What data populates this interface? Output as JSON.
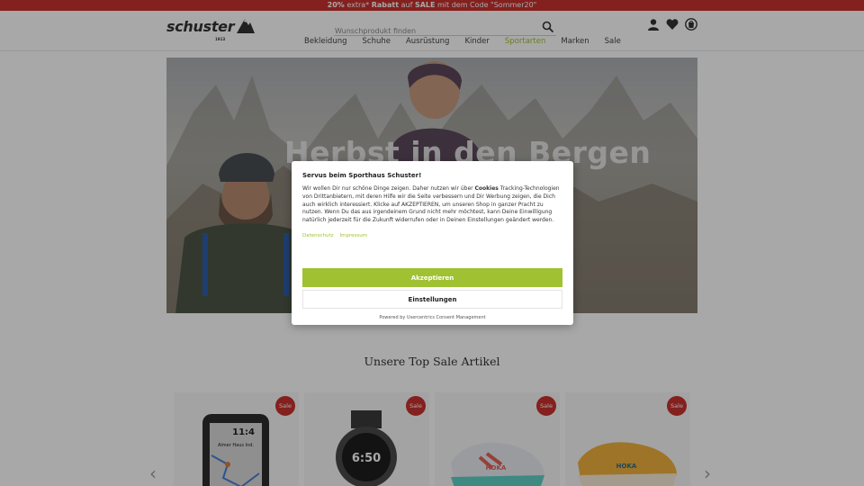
{
  "promo": {
    "part1": "20%",
    "part2": " extra* ",
    "part3": "Rabatt",
    "part4": " auf ",
    "part5": "SALE",
    "part6": " mit dem Code \"Sommer20\""
  },
  "header": {
    "logo": "schuster",
    "logo_sub": "1913",
    "search_placeholder": "Wunschprodukt finden"
  },
  "nav": [
    "Bekleidung",
    "Schuhe",
    "Ausrüstung",
    "Kinder",
    "Sportarten",
    "Marken",
    "Sale"
  ],
  "hero": {
    "title": "Herbst in den Bergen"
  },
  "section": {
    "title": "Unsere Top Sale Artikel"
  },
  "products": [
    {
      "badge": "Sale",
      "screen_top": "11:4",
      "screen_sub": "Almer Haus Ind."
    },
    {
      "badge": "Sale",
      "screen_top": "6:50",
      "screen_sub": ""
    },
    {
      "badge": "Sale",
      "brand_mark": "HOKA"
    },
    {
      "badge": "Sale",
      "brand_mark": "HOKA"
    }
  ],
  "consent": {
    "title": "Servus beim Sporthaus Schuster!",
    "body_1": "Wir wollen Dir nur schöne Dinge zeigen. Daher nutzen wir über ",
    "body_bold": "Cookies",
    "body_2": " Tracking-Technologien von Drittanbietern, mit deren Hilfe wir die Seite verbessern und Dir Werbung zeigen, die Dich auch wirklich interessiert. Klicke auf AKZEPTIEREN, um unseren Shop in ganzer Pracht zu nutzen. Wenn Du das aus irgendeinem Grund nicht mehr möchtest, kann Deine Einwilligung natürlich jederzeit für die Zukunft widerrufen oder in Deinen Einstellungen geändert werden.",
    "link_privacy": "Datenschutz",
    "link_imprint": "Impressum",
    "accept_label": "Akzeptieren",
    "settings_label": "Einstellungen",
    "powered": "Powered by Usercentrics Consent Management"
  },
  "colors": {
    "brand_green": "#9fc132",
    "promo_red": "#c8312e"
  }
}
